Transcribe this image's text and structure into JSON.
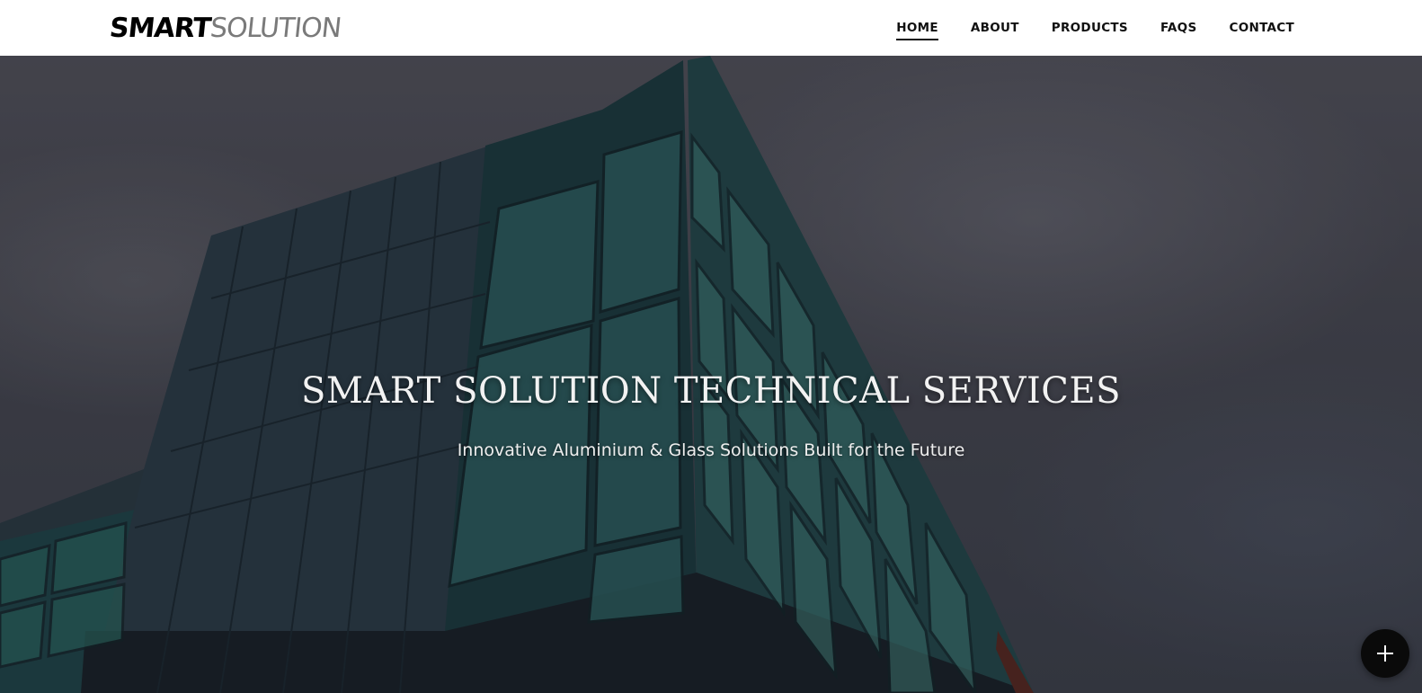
{
  "header": {
    "logo": {
      "part_a": "SMART",
      "part_b": "SOLUTION"
    },
    "nav": [
      {
        "label": "HOME",
        "active": true
      },
      {
        "label": "ABOUT",
        "active": false
      },
      {
        "label": "PRODUCTS",
        "active": false
      },
      {
        "label": "FAQS",
        "active": false
      },
      {
        "label": "CONTACT",
        "active": false
      }
    ]
  },
  "hero": {
    "title": "SMART SOLUTION TECHNICAL SERVICES",
    "subtitle": "Innovative Aluminium & Glass Solutions Built for the Future",
    "background_image": "modern-glass-building-photo"
  },
  "fab": {
    "icon": "plus-icon"
  },
  "colors": {
    "header_bg": "#ffffff",
    "nav_text": "#111111",
    "hero_text": "#f2f2f2",
    "fab_bg": "#0a0a0a"
  }
}
